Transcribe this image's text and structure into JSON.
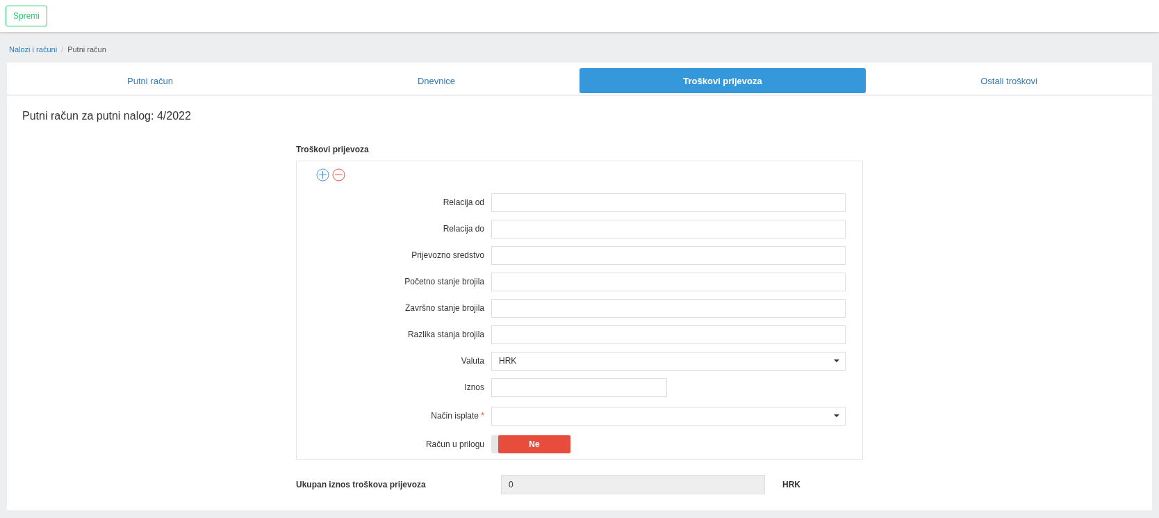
{
  "toolbar": {
    "save_button": "Spremi"
  },
  "breadcrumb": {
    "separator": "/",
    "items": [
      {
        "label": "Nalozi i računi",
        "link": true
      },
      {
        "label": "Putni račun",
        "link": false
      }
    ]
  },
  "tabs": [
    {
      "label": "Putni račun",
      "selected": false
    },
    {
      "label": "Dnevnice",
      "selected": false
    },
    {
      "label": "Troškovi prijevoza",
      "selected": true
    },
    {
      "label": "Ostali troškovi",
      "selected": false
    }
  ],
  "page_title": "Putni račun za putni nalog: 4/2022",
  "section": {
    "title": "Troškovi prijevoza",
    "fields": [
      {
        "label": "Relacija od",
        "kind": "text"
      },
      {
        "label": "Relacija do",
        "kind": "text"
      },
      {
        "label": "Prijevozno sredstvo",
        "kind": "text"
      },
      {
        "label": "Početno stanje brojila",
        "kind": "text"
      },
      {
        "label": "Završno stanje brojila",
        "kind": "text"
      },
      {
        "label": "Razlika stanja brojila",
        "kind": "text"
      },
      {
        "label": "Valuta",
        "kind": "select",
        "value": "HRK"
      },
      {
        "label": "Iznos",
        "kind": "short"
      },
      {
        "label": "Način isplate",
        "kind": "select",
        "required_mark": "*"
      },
      {
        "label": "Račun u prilogu",
        "kind": "toggle",
        "value": "Ne",
        "on": false
      }
    ]
  },
  "total": {
    "label": "Ukupan iznos troškova prijevoza",
    "value": "0",
    "currency": "HRK"
  }
}
